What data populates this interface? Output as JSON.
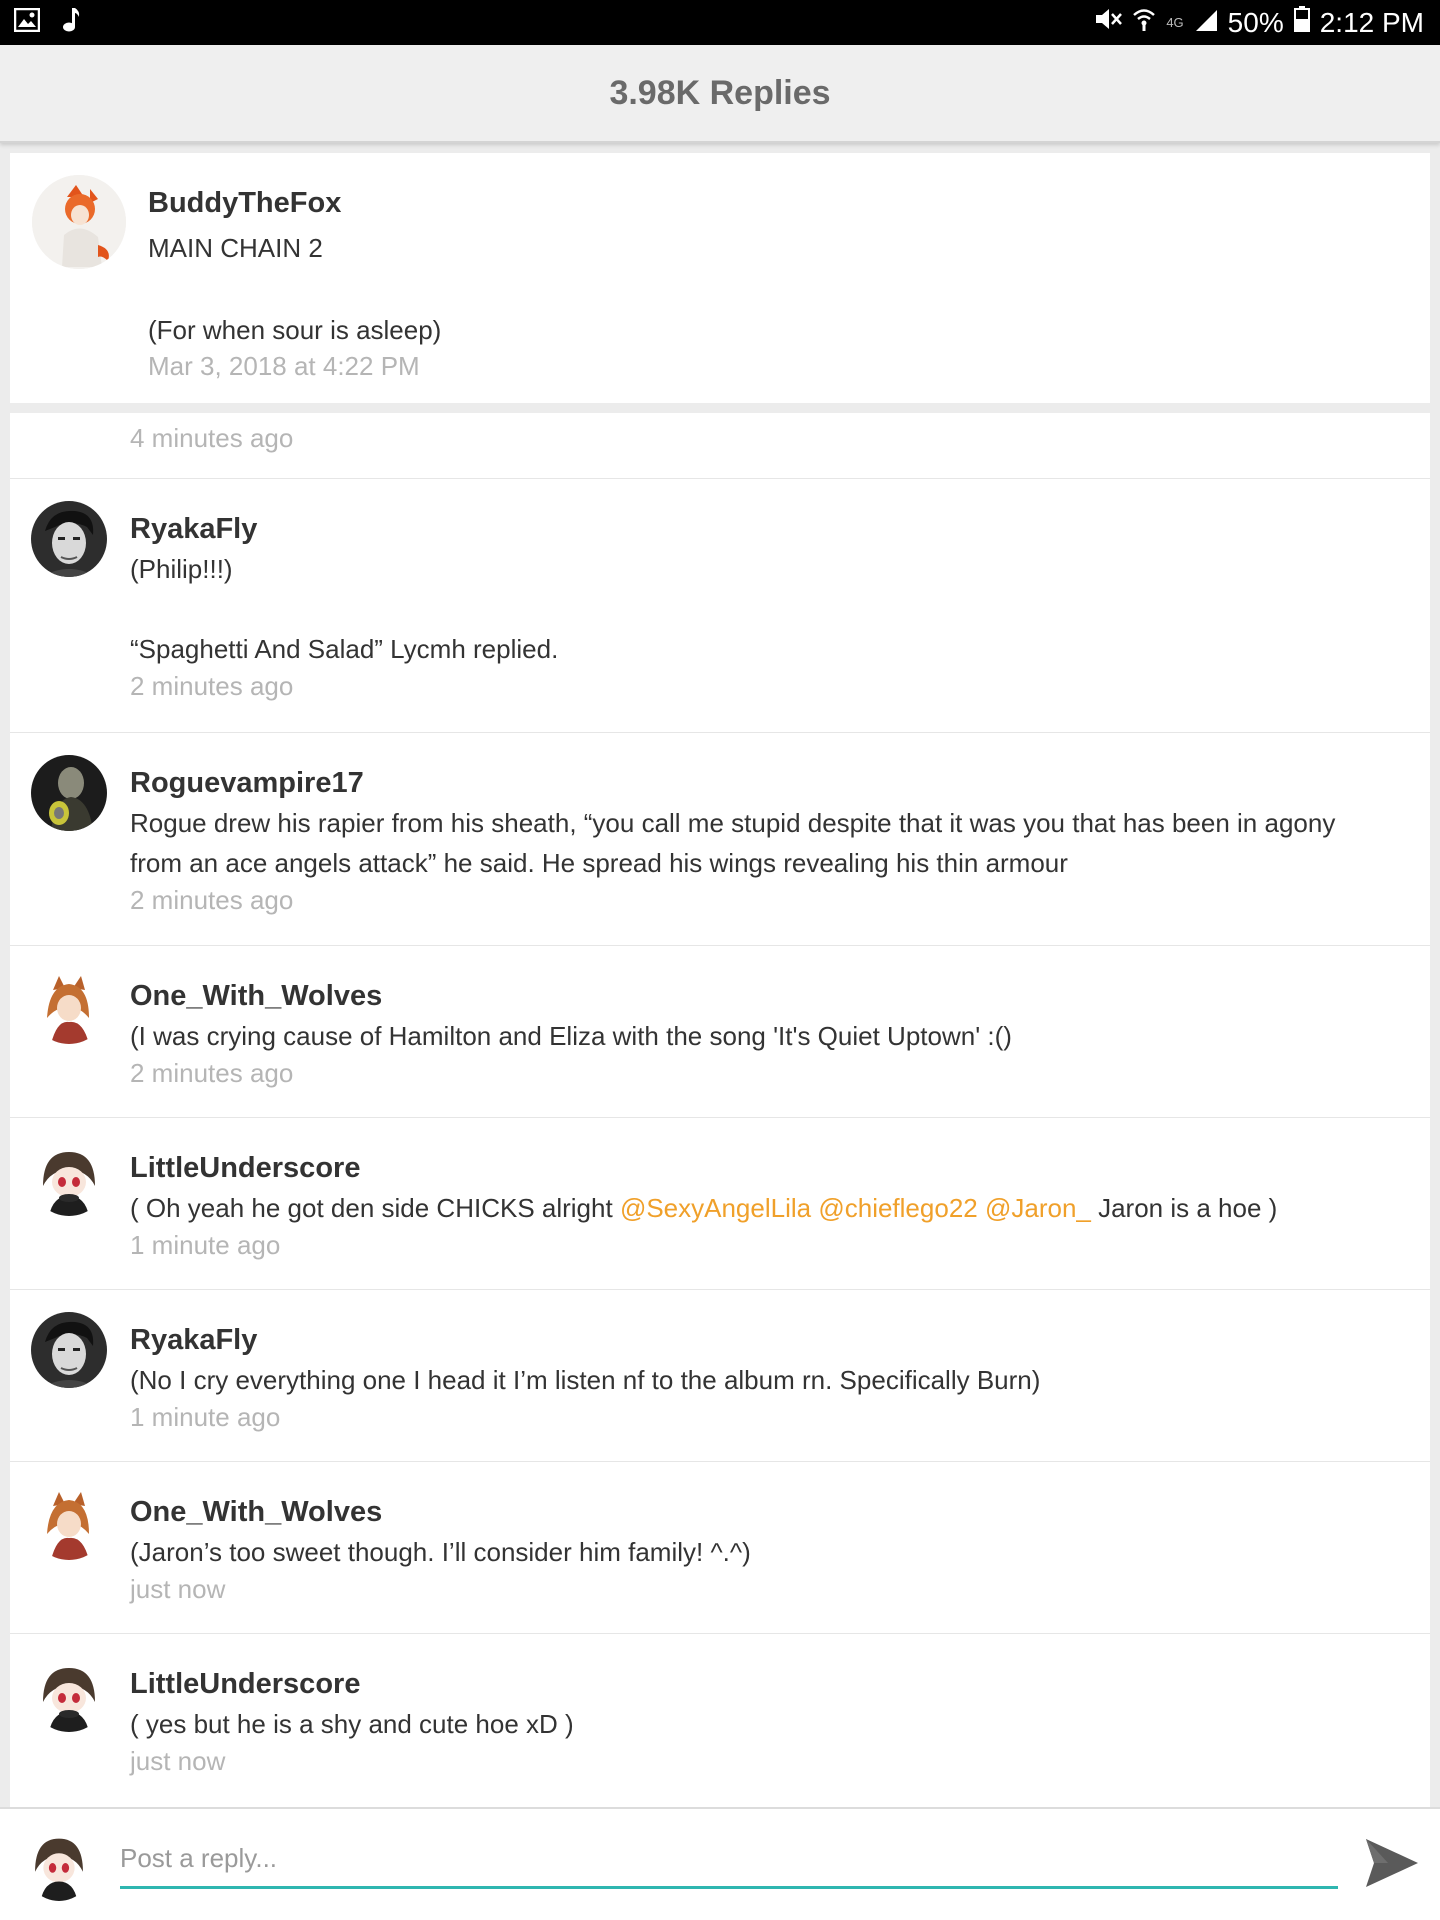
{
  "status_bar": {
    "left_icons": [
      "image-icon",
      "music-note-icon"
    ],
    "right_icons": [
      "mute-icon",
      "wifi-icon",
      "signal-icon",
      "battery-icon"
    ],
    "network": "4G",
    "battery": "50%",
    "time": "2:12 PM"
  },
  "header": {
    "title": "3.98K Replies"
  },
  "original_post": {
    "author": "BuddyTheFox",
    "line1": "MAIN CHAIN 2",
    "line2": "(For when sour is asleep)",
    "timestamp": "Mar 3, 2018 at 4:22 PM"
  },
  "cut_reply": {
    "timestamp": "4 minutes ago"
  },
  "replies": [
    {
      "author": "RyakaFly",
      "line1": "(Philip!!!)",
      "line2": "“Spaghetti And Salad” Lycmh replied.",
      "timestamp": "2 minutes ago"
    },
    {
      "author": "Roguevampire17",
      "line1": "Rogue drew his rapier from his sheath, “you call me stupid despite that it was you that has been in agony",
      "line2": "from an ace angels attack” he said. He spread his wings revealing his thin armour",
      "timestamp": "2 minutes ago"
    },
    {
      "author": "One_With_Wolves",
      "text": "(I was crying cause of Hamilton and Eliza with the song 'It's Quiet Uptown' :()",
      "timestamp": "2 minutes ago"
    },
    {
      "author": "LittleUnderscore",
      "text_before": "( Oh yeah he got den side CHICKS alright ",
      "mentions": [
        "@SexyAngelLila",
        "@chieflego22",
        "@Jaron_"
      ],
      "text_after": " Jaron is a hoe )",
      "timestamp": "1 minute ago"
    },
    {
      "author": "RyakaFly",
      "text": "(No I cry everything one I head it I’m listen nf to the album rn. Specifically Burn)",
      "timestamp": "1 minute ago"
    },
    {
      "author": "One_With_Wolves",
      "text": "(Jaron’s too sweet though. I’ll consider him family! ^.^)",
      "timestamp": "just now"
    },
    {
      "author": "LittleUnderscore",
      "text": "( yes but he is a shy and cute hoe xD )",
      "timestamp": "just now"
    }
  ],
  "composer": {
    "placeholder": "Post a reply...",
    "send_icon": "send-icon"
  },
  "colors": {
    "mention": "#f0a02a",
    "input_underline": "#2fb6b0",
    "timestamp": "#b5b5b5"
  }
}
